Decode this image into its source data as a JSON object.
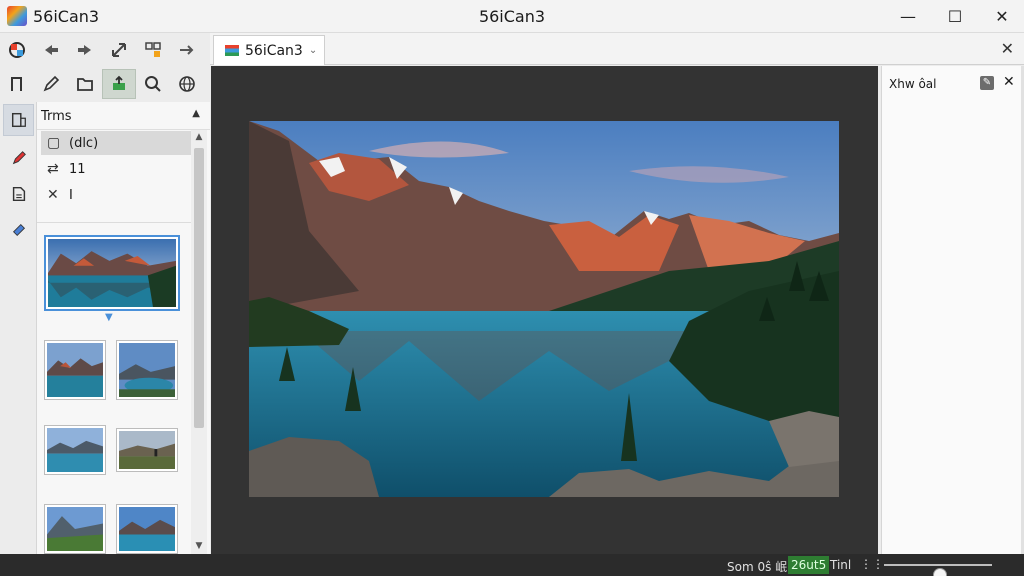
{
  "window": {
    "title": "56iCan3",
    "app_name": "56iCan3",
    "controls": {
      "minimize": "—",
      "maximize": "☐",
      "close": "✕"
    }
  },
  "toolbar": {
    "row1": [
      "refresh-icon",
      "back-icon",
      "forward-icon",
      "transform-icon",
      "grid-select-icon",
      "next-icon"
    ],
    "row2": [
      "bookmark-icon",
      "pen-icon",
      "folder-icon",
      "export-icon",
      "search-icon",
      "globe-icon"
    ]
  },
  "tab": {
    "label": "56iCan3",
    "caret": "⌄",
    "close": "✕"
  },
  "rail": [
    "document-icon",
    "pencil-icon",
    "file-icon",
    "tag-icon"
  ],
  "panel": {
    "title": "Trms",
    "collapse": "▲",
    "items": [
      {
        "icon": "▢",
        "label": "(dlc)"
      },
      {
        "icon": "⇄",
        "label": "11"
      },
      {
        "icon": "✕",
        "label": "I"
      }
    ],
    "scroll_up": "▲",
    "scroll_down": "▼"
  },
  "right_panel": {
    "title": "Xhw ôal",
    "edit": "✎",
    "close": "✕"
  },
  "status": {
    "text": "Som 0ŝ 岷",
    "highlight": "26ut5",
    "tail": "Tinl",
    "grid": "⋮⋮",
    "zoom_fraction": 0.52
  },
  "colors": {
    "accent": "#4a90d9",
    "canvas": "#333333",
    "status_green": "#2e7d32"
  }
}
